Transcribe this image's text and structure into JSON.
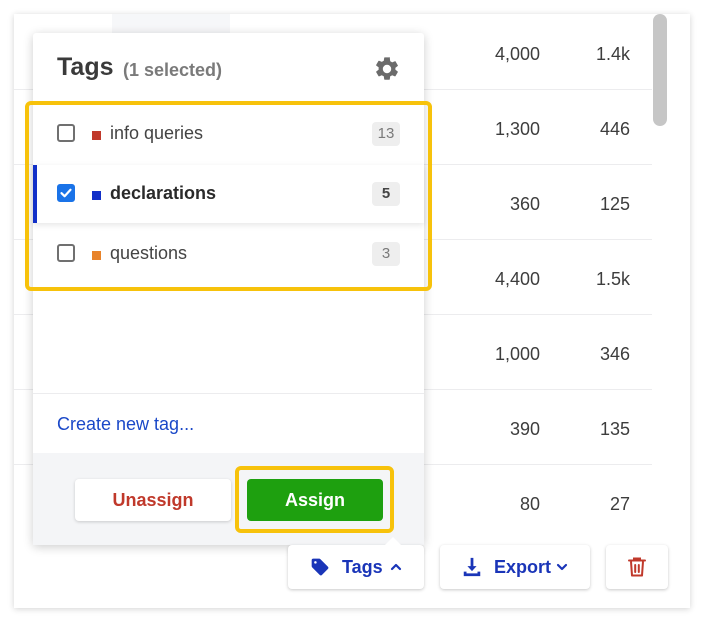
{
  "table": {
    "rows": [
      {
        "volume": "4,000",
        "value": "1.4k"
      },
      {
        "volume": "1,300",
        "value": "446"
      },
      {
        "volume": "360",
        "value": "125"
      },
      {
        "volume": "4,400",
        "value": "1.5k"
      },
      {
        "volume": "1,000",
        "value": "346"
      },
      {
        "volume": "390",
        "value": "135"
      },
      {
        "volume": "80",
        "value": "27"
      }
    ]
  },
  "popover": {
    "title": "Tags",
    "subtitle": "(1  selected)",
    "settings_icon": "gear-icon",
    "tags": [
      {
        "label": "info queries",
        "count": "13",
        "color": "#c0392b",
        "checked": false
      },
      {
        "label": "declarations",
        "count": "5",
        "color": "#1230c8",
        "checked": true
      },
      {
        "label": "questions",
        "count": "3",
        "color": "#e8832a",
        "checked": false
      }
    ],
    "create_link": "Create new tag...",
    "unassign_label": "Unassign",
    "assign_label": "Assign"
  },
  "toolbar": {
    "tags_label": "Tags",
    "tags_icon": "tag-icon",
    "export_label": "Export",
    "export_icon": "download-icon",
    "delete_icon": "trash-icon"
  },
  "colors": {
    "accent": "#1a35b8",
    "assign": "#1ea00f",
    "unassign_text": "#c0392b",
    "highlight": "#f7c20b"
  }
}
